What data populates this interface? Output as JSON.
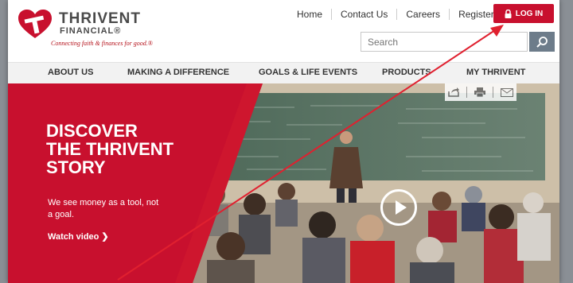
{
  "brand": {
    "name_line1": "THRIVENT",
    "name_line2": "FINANCIAL®",
    "tagline": "Connecting faith & finances for good.®",
    "color": "#c8102e"
  },
  "utility_nav": [
    "Home",
    "Contact Us",
    "Careers",
    "Register"
  ],
  "login": {
    "label": "LOG IN",
    "icon": "lock-icon"
  },
  "search": {
    "placeholder": "Search",
    "icon": "magnifier-icon"
  },
  "main_nav": [
    "ABOUT US",
    "MAKING A DIFFERENCE",
    "GOALS & LIFE EVENTS",
    "PRODUCTS",
    "MY THRIVENT"
  ],
  "hero": {
    "title_lines": [
      "DISCOVER",
      "THE THRIVENT",
      "STORY"
    ],
    "subtitle": "We see money as a tool, not a goal.",
    "cta": "Watch video ❯",
    "share_icons": [
      "share-icon",
      "print-icon",
      "email-icon"
    ]
  }
}
